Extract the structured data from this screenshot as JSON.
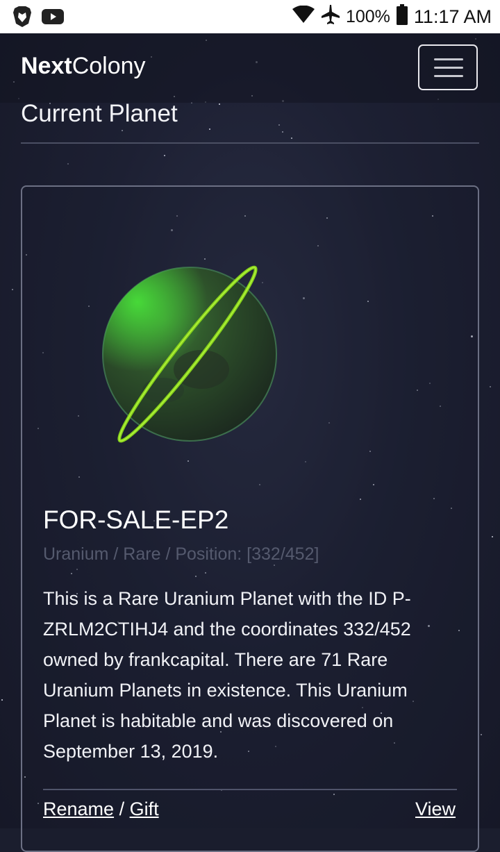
{
  "status_bar": {
    "left_icons": [
      "brave-lion-icon",
      "youtube-icon"
    ],
    "battery": "100%",
    "time": "11:17 AM",
    "right_icons": [
      "wifi-icon",
      "airplane-icon",
      "battery-icon"
    ]
  },
  "navbar": {
    "brand_bold": "Next",
    "brand_regular": "Colony",
    "menu_icon": "hamburger-icon"
  },
  "page": {
    "title": "Current Planet"
  },
  "planet": {
    "name": "FOR-SALE-EP2",
    "meta": "Uranium / Rare / Position: [332/452]",
    "description": "This is a Rare Uranium Planet with the ID P-ZRLM2CTIHJ4 and the coordinates 332/452 owned by frankcapital. There are 71 Rare Uranium Planets in existence. This Uranium Planet is habitable and was discovered on September 13, 2019.",
    "actions": {
      "rename": "Rename",
      "separator": " / ",
      "gift": "Gift",
      "view": "View"
    },
    "colors": {
      "planet": "#2f5a2c",
      "glow": "#39d62a",
      "ring": "#7fd21a"
    }
  }
}
